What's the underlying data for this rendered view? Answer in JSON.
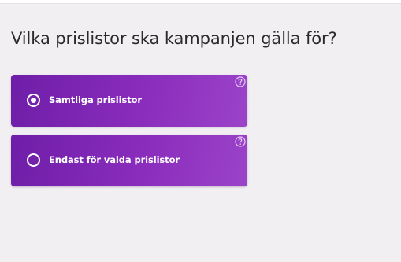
{
  "question": {
    "title": "Vilka prislistor ska kampanjen gälla för?"
  },
  "options": [
    {
      "label": "Samtliga prislistor",
      "selected": true,
      "help_icon": "question-circle-icon"
    },
    {
      "label": "Endast för valda prislistor",
      "selected": false,
      "help_icon": "question-circle-icon"
    }
  ],
  "colors": {
    "card_start": "#6e1ea8",
    "card_end": "#9b43c9",
    "background": "#f1eff2",
    "text": "#2a2a2a"
  }
}
